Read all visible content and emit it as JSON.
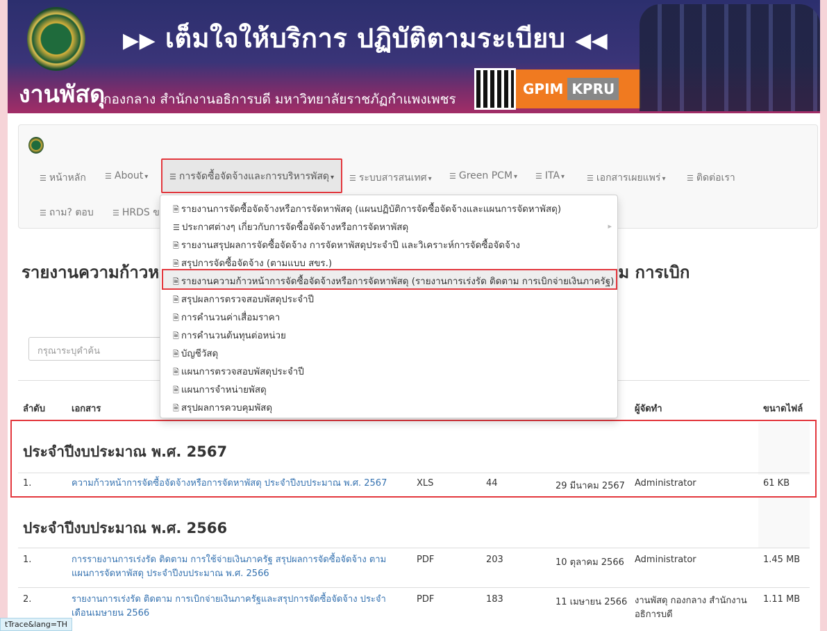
{
  "banner": {
    "slogan": "เต็มใจให้บริการ ปฏิบัติตามระเบียบ",
    "arrow_left": "▶▶",
    "arrow_right": "◀◀",
    "org_big": "งานพัสดุ",
    "org_small": "กองกลาง สำนักงานอธิการบดี มหาวิทยาลัยราชภัฏกำแพงเพชร",
    "gpim": "GPIM",
    "kpru": "KPRU"
  },
  "nav": {
    "items": [
      {
        "label": "หน้าหลัก"
      },
      {
        "label": "About"
      },
      {
        "label": "การจัดซื้อจัดจ้างและการบริหารพัสดุ"
      },
      {
        "label": "ระบบสารสนเทศ"
      },
      {
        "label": "Green PCM"
      },
      {
        "label": "ITA"
      },
      {
        "label": "เอกสารเผยแพร่"
      },
      {
        "label": "ติดต่อเรา"
      },
      {
        "label": "ถาม? ตอบ"
      },
      {
        "label": "HRDS ขอ"
      }
    ]
  },
  "dropdown": {
    "items": [
      {
        "label": "รายงานการจัดซื้อจัดจ้างหรือการจัดหาพัสดุ (แผนปฏิบัติการจัดซื้อจัดจ้างและแผนการจัดหาพัสดุ)"
      },
      {
        "label": "ประกาศต่างๆ เกี่ยวกับการจัดซื้อจัดจ้างหรือการจัดหาพัสดุ"
      },
      {
        "label": "รายงานสรุปผลการจัดซื้อจัดจ้าง การจัดหาพัสดุประจำปี และวิเคราะห์การจัดซื้อจัดจ้าง"
      },
      {
        "label": "สรุปการจัดซื้อจัดจ้าง (ตามแบบ สขร.)"
      },
      {
        "label": "รายงานความก้าวหน้าการจัดซื้อจัดจ้างหรือการจัดหาพัสดุ (รายงานการเร่งรัด ติดตาม การเบิกจ่ายเงินภาครัฐ)"
      },
      {
        "label": "สรุปผลการตรวจสอบพัสดุประจำปี"
      },
      {
        "label": "การคำนวนค่าเสื่อมราคา"
      },
      {
        "label": "การคำนวนต้นทุนต่อหน่วย"
      },
      {
        "label": "บัญชีวัสดุ"
      },
      {
        "label": "แผนการตรวจสอบพัสดุประจำปี"
      },
      {
        "label": "แผนการจำหน่ายพัสดุ"
      },
      {
        "label": "สรุปผลการควบคุมพัสดุ"
      }
    ]
  },
  "page": {
    "heading": "รายงานความก้าวหน้าการจัดซื้อจัดจ้างหรือการจัดหาพัสดุ (รายงานการเร่งรัด ติดตาม การเบิก",
    "search_placeholder": "กรุณาระบุคำค้น"
  },
  "table": {
    "headers": {
      "no": "ลำดับ",
      "doc": "เอกสาร",
      "author": "ผู้จัดทำ",
      "size": "ขนาดไฟล์"
    },
    "sections": [
      {
        "title": "ประจำปีงบประมาณ พ.ศ. 2567",
        "rows": [
          {
            "no": "1.",
            "doc": "ความก้าวหน้าการจัดซื้อจัดจ้างหรือการจัดหาพัสดุ ประจำปีงบประมาณ พ.ศ. 2567",
            "type": "XLS",
            "views": "44",
            "date": "29 มีนาคม 2567",
            "author": "Administrator",
            "size": "61 KB"
          }
        ]
      },
      {
        "title": "ประจำปีงบประมาณ พ.ศ. 2566",
        "rows": [
          {
            "no": "1.",
            "doc_line1": "การรายงานการเร่งรัด ติดตาม การใช้จ่ายเงินภาครัฐ สรุปผลการจัดซื้อจัดจ้าง ตาม",
            "doc_line2": "แผนการจัดหาพัสดุ ประจำปีงบประมาณ พ.ศ. 2566",
            "type": "PDF",
            "views": "203",
            "date": "10 ตุลาคม 2566",
            "author": "Administrator",
            "size": "1.45 MB"
          },
          {
            "no": "2.",
            "doc_line1": "รายงานการเร่งรัด ติดตาม การเบิกจ่ายเงินภาครัฐและสรุปการจัดซื้อจัดจ้าง ประจำ",
            "doc_line2": "เดือนเมษายน 2566",
            "type": "PDF",
            "views": "183",
            "date": "11 เมษายน 2566",
            "author_line1": "งานพัสดุ กองกลาง สำนักงาน",
            "author_line2": "อธิการบดี",
            "size": "1.11 MB"
          }
        ]
      }
    ]
  },
  "status_tip": "tTrace&lang=TH"
}
